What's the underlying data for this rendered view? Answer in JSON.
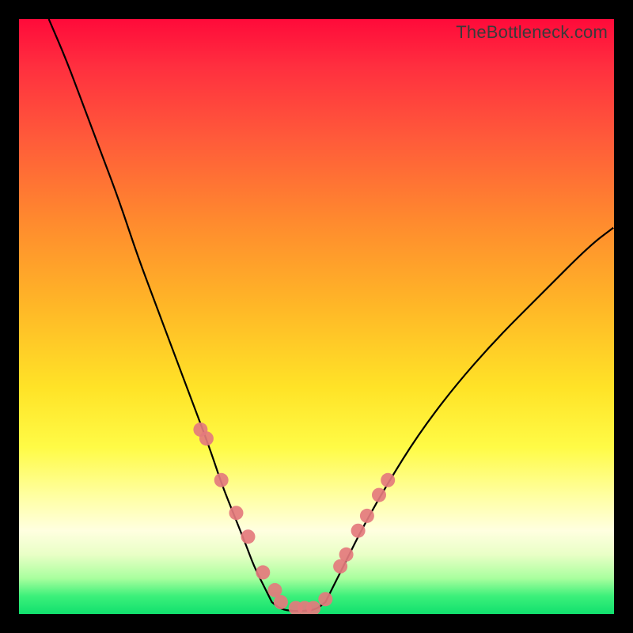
{
  "watermark": "TheBottleneck.com",
  "chart_data": {
    "type": "line",
    "title": "",
    "xlabel": "",
    "ylabel": "",
    "xlim": [
      0,
      100
    ],
    "ylim": [
      0,
      100
    ],
    "series": [
      {
        "name": "left-curve",
        "x": [
          5,
          8,
          11,
          14,
          17,
          20,
          23,
          26,
          29,
          32,
          34,
          36,
          38,
          39.5,
          41,
          42.5
        ],
        "y": [
          100,
          93,
          85,
          77,
          69,
          60,
          52,
          44,
          36,
          28,
          22,
          17,
          12,
          8,
          5,
          2
        ]
      },
      {
        "name": "bottom-flat",
        "x": [
          42.5,
          44,
          46,
          48,
          50,
          51.5
        ],
        "y": [
          2,
          0.8,
          0.5,
          0.5,
          0.8,
          2
        ]
      },
      {
        "name": "right-curve",
        "x": [
          51.5,
          53,
          55,
          58,
          62,
          67,
          73,
          80,
          88,
          96,
          100
        ],
        "y": [
          2,
          5,
          9,
          15,
          22,
          30,
          38,
          46,
          54,
          62,
          65
        ]
      }
    ],
    "markers": {
      "name": "dots",
      "x": [
        30.5,
        31.5,
        34,
        36.5,
        38.5,
        41,
        44,
        46.5,
        49.5,
        51.5,
        54,
        55,
        57,
        58.5,
        60.5,
        62,
        43,
        48
      ],
      "y": [
        31,
        29.5,
        22.5,
        17,
        13,
        7,
        2,
        1,
        1,
        2.5,
        8,
        10,
        14,
        16.5,
        20,
        22.5,
        4,
        1
      ]
    },
    "gradient_bands": {
      "note": "background vertical gradient red→orange→yellow→pale→green representing bottleneck severity",
      "top_color": "#ff0a3a",
      "bottom_color": "#11e06e"
    }
  },
  "colors": {
    "curve": "#000000",
    "marker": "#e47a7d",
    "frame": "#000000"
  }
}
